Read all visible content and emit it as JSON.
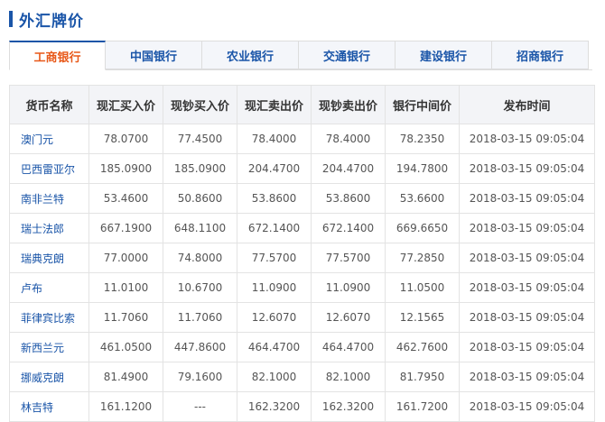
{
  "header": {
    "title": "外汇牌价"
  },
  "tabs": [
    {
      "label": "工商银行",
      "active": true
    },
    {
      "label": "中国银行",
      "active": false
    },
    {
      "label": "农业银行",
      "active": false
    },
    {
      "label": "交通银行",
      "active": false
    },
    {
      "label": "建设银行",
      "active": false
    },
    {
      "label": "招商银行",
      "active": false
    }
  ],
  "table": {
    "columns": [
      "货币名称",
      "现汇买入价",
      "现钞买入价",
      "现汇卖出价",
      "现钞卖出价",
      "银行中间价",
      "发布时间"
    ],
    "rows": [
      [
        "澳门元",
        "78.0700",
        "77.4500",
        "78.4000",
        "78.4000",
        "78.2350",
        "2018-03-15 09:05:04"
      ],
      [
        "巴西雷亚尔",
        "185.0900",
        "185.0900",
        "204.4700",
        "204.4700",
        "194.7800",
        "2018-03-15 09:05:04"
      ],
      [
        "南非兰特",
        "53.4600",
        "50.8600",
        "53.8600",
        "53.8600",
        "53.6600",
        "2018-03-15 09:05:04"
      ],
      [
        "瑞士法郎",
        "667.1900",
        "648.1100",
        "672.1400",
        "672.1400",
        "669.6650",
        "2018-03-15 09:05:04"
      ],
      [
        "瑞典克朗",
        "77.0000",
        "74.8000",
        "77.5700",
        "77.5700",
        "77.2850",
        "2018-03-15 09:05:04"
      ],
      [
        "卢布",
        "11.0100",
        "10.6700",
        "11.0900",
        "11.0900",
        "11.0500",
        "2018-03-15 09:05:04"
      ],
      [
        "菲律宾比索",
        "11.7060",
        "11.7060",
        "12.6070",
        "12.6070",
        "12.1565",
        "2018-03-15 09:05:04"
      ],
      [
        "新西兰元",
        "461.0500",
        "447.8600",
        "464.4700",
        "464.4700",
        "462.7600",
        "2018-03-15 09:05:04"
      ],
      [
        "挪威克朗",
        "81.4900",
        "79.1600",
        "82.1000",
        "82.1000",
        "81.7950",
        "2018-03-15 09:05:04"
      ],
      [
        "林吉特",
        "161.1200",
        "---",
        "162.3200",
        "162.3200",
        "161.7200",
        "2018-03-15 09:05:04"
      ]
    ]
  },
  "colors": {
    "accent_blue": "#1a55a8",
    "active_tab_text": "#e8591a"
  }
}
